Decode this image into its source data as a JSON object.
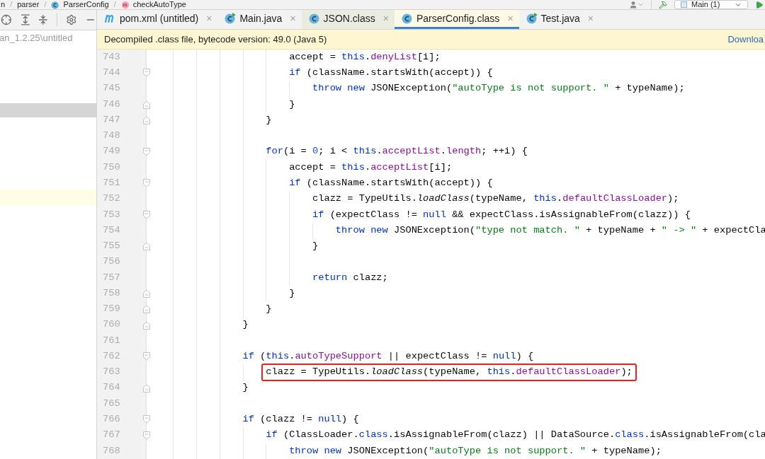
{
  "breadcrumb": [
    {
      "text": "n",
      "kind": "plain"
    },
    {
      "separator": "/",
      "text": "parser",
      "kind": "plain"
    },
    {
      "separator": "/",
      "text": "ParserConfig",
      "kind": "class"
    },
    {
      "separator": "/",
      "text": "checkAutoType",
      "kind": "method"
    }
  ],
  "run_config": {
    "label": "Main (1)"
  },
  "project_panel": {
    "path": "an_1.2.25\\untitled",
    "bands": [
      {
        "kind": "selection"
      },
      {
        "kind": "caret"
      }
    ]
  },
  "tabs": [
    {
      "label": "pom.xml (untitled)",
      "kind": "maven",
      "close": "×",
      "selected": false
    },
    {
      "label": "Main.java",
      "kind": "runnable",
      "close": "×",
      "selected": false
    },
    {
      "label": "JSON.class",
      "kind": "class",
      "close": "×",
      "selected": false,
      "color": "#e9ecdf"
    },
    {
      "label": "ParserConfig.class",
      "kind": "class",
      "close": "×",
      "selected": true,
      "color": "#fcfae6"
    },
    {
      "label": "Test.java",
      "kind": "runnable",
      "close": "×",
      "selected": false
    }
  ],
  "banner": {
    "message": "Decompiled .class file, bytecode version: 49.0 (Java 5)",
    "link": "Downloa"
  },
  "code": {
    "lines": [
      {
        "number": "743",
        "kind": "plain",
        "tokens": [
          {
            "kind": "plain",
            "text": "                        accept = "
          },
          {
            "kind": "keyword",
            "text": "this"
          },
          {
            "kind": "plain",
            "text": "."
          },
          {
            "kind": "field",
            "text": "denyList"
          },
          {
            "kind": "plain",
            "text": "[i];"
          }
        ]
      },
      {
        "number": "744",
        "kind": "opener",
        "tokens": [
          {
            "kind": "keyword",
            "text": "                        if"
          },
          {
            "kind": "plain",
            "text": " (className.startsWith(accept)) {"
          }
        ]
      },
      {
        "number": "745",
        "kind": "plain",
        "tokens": [
          {
            "kind": "keyword",
            "text": "                            throw new"
          },
          {
            "kind": "plain",
            "text": " JSONException("
          },
          {
            "kind": "string",
            "text": "\"autoType is not support. \""
          },
          {
            "kind": "plain",
            "text": " + typeName);"
          }
        ]
      },
      {
        "number": "746",
        "kind": "closer",
        "tokens": [
          {
            "kind": "plain",
            "text": "                        }"
          }
        ]
      },
      {
        "number": "747",
        "kind": "closer",
        "tokens": [
          {
            "kind": "plain",
            "text": "                    }"
          }
        ]
      },
      {
        "number": "748",
        "kind": "plain"
      },
      {
        "number": "749",
        "kind": "opener",
        "tokens": [
          {
            "kind": "keyword",
            "text": "                    for"
          },
          {
            "kind": "plain",
            "text": "(i = "
          },
          {
            "kind": "number",
            "text": "0"
          },
          {
            "kind": "plain",
            "text": "; i < "
          },
          {
            "kind": "keyword",
            "text": "this"
          },
          {
            "kind": "plain",
            "text": "."
          },
          {
            "kind": "field",
            "text": "acceptList"
          },
          {
            "kind": "plain",
            "text": "."
          },
          {
            "kind": "field",
            "text": "length"
          },
          {
            "kind": "plain",
            "text": "; ++i) {"
          }
        ]
      },
      {
        "number": "750",
        "kind": "plain",
        "tokens": [
          {
            "kind": "plain",
            "text": "                        accept = "
          },
          {
            "kind": "keyword",
            "text": "this"
          },
          {
            "kind": "plain",
            "text": "."
          },
          {
            "kind": "field",
            "text": "acceptList"
          },
          {
            "kind": "plain",
            "text": "[i];"
          }
        ]
      },
      {
        "number": "751",
        "kind": "opener",
        "tokens": [
          {
            "kind": "keyword",
            "text": "                        if"
          },
          {
            "kind": "plain",
            "text": " (className.startsWith(accept)) {"
          }
        ]
      },
      {
        "number": "752",
        "kind": "plain",
        "tokens": [
          {
            "kind": "plain",
            "text": "                            clazz = TypeUtils."
          },
          {
            "kind": "method",
            "text": "loadClass"
          },
          {
            "kind": "plain",
            "text": "(typeName, "
          },
          {
            "kind": "keyword",
            "text": "this"
          },
          {
            "kind": "plain",
            "text": "."
          },
          {
            "kind": "field",
            "text": "defaultClassLoader"
          },
          {
            "kind": "plain",
            "text": ");"
          }
        ]
      },
      {
        "number": "753",
        "kind": "opener",
        "tokens": [
          {
            "kind": "keyword",
            "text": "                            if"
          },
          {
            "kind": "plain",
            "text": " (expectClass != "
          },
          {
            "kind": "keyword",
            "text": "null"
          },
          {
            "kind": "plain",
            "text": " && expectClass.isAssignableFrom(clazz)) {"
          }
        ]
      },
      {
        "number": "754",
        "kind": "plain",
        "tokens": [
          {
            "kind": "keyword",
            "text": "                                throw new"
          },
          {
            "kind": "plain",
            "text": " JSONException("
          },
          {
            "kind": "string",
            "text": "\"type not match. \""
          },
          {
            "kind": "plain",
            "text": " + typeName + "
          },
          {
            "kind": "string",
            "text": "\" -> \""
          },
          {
            "kind": "plain",
            "text": " + expectCla"
          }
        ]
      },
      {
        "number": "755",
        "kind": "closer",
        "tokens": [
          {
            "kind": "plain",
            "text": "                            }"
          }
        ]
      },
      {
        "number": "756",
        "kind": "plain"
      },
      {
        "number": "757",
        "kind": "plain",
        "tokens": [
          {
            "kind": "keyword",
            "text": "                            return"
          },
          {
            "kind": "plain",
            "text": " clazz;"
          }
        ]
      },
      {
        "number": "758",
        "kind": "closer",
        "tokens": [
          {
            "kind": "plain",
            "text": "                        }"
          }
        ]
      },
      {
        "number": "759",
        "kind": "closer",
        "tokens": [
          {
            "kind": "plain",
            "text": "                    }"
          }
        ]
      },
      {
        "number": "760",
        "kind": "closer",
        "tokens": [
          {
            "kind": "plain",
            "text": "                }"
          }
        ]
      },
      {
        "number": "761",
        "kind": "plain"
      },
      {
        "number": "762",
        "kind": "opener",
        "tokens": [
          {
            "kind": "keyword",
            "text": "                if"
          },
          {
            "kind": "plain",
            "text": " ("
          },
          {
            "kind": "keyword",
            "text": "this"
          },
          {
            "kind": "plain",
            "text": "."
          },
          {
            "kind": "field",
            "text": "autoTypeSupport"
          },
          {
            "kind": "plain",
            "text": " || expectClass != "
          },
          {
            "kind": "keyword",
            "text": "null"
          },
          {
            "kind": "plain",
            "text": ") {"
          }
        ]
      },
      {
        "number": "763",
        "kind": "plain",
        "highlighted": true,
        "tokens": [
          {
            "kind": "plain",
            "text": "                    clazz = TypeUtils."
          },
          {
            "kind": "method",
            "text": "loadClass"
          },
          {
            "kind": "plain",
            "text": "(typeName, "
          },
          {
            "kind": "keyword",
            "text": "this"
          },
          {
            "kind": "plain",
            "text": "."
          },
          {
            "kind": "field",
            "text": "defaultClassLoader"
          },
          {
            "kind": "plain",
            "text": ");"
          }
        ]
      },
      {
        "number": "764",
        "kind": "closer",
        "tokens": [
          {
            "kind": "plain",
            "text": "                }"
          }
        ]
      },
      {
        "number": "765",
        "kind": "plain"
      },
      {
        "number": "766",
        "kind": "opener",
        "tokens": [
          {
            "kind": "keyword",
            "text": "                if"
          },
          {
            "kind": "plain",
            "text": " (clazz != "
          },
          {
            "kind": "keyword",
            "text": "null"
          },
          {
            "kind": "plain",
            "text": ") {"
          }
        ]
      },
      {
        "number": "767",
        "kind": "opener",
        "tokens": [
          {
            "kind": "keyword",
            "text": "                    if"
          },
          {
            "kind": "plain",
            "text": " (ClassLoader."
          },
          {
            "kind": "keyword",
            "text": "class"
          },
          {
            "kind": "plain",
            "text": ".isAssignableFrom(clazz) || DataSource."
          },
          {
            "kind": "keyword",
            "text": "class"
          },
          {
            "kind": "plain",
            "text": ".isAssignableFrom(cla"
          }
        ]
      },
      {
        "number": "768",
        "kind": "plain",
        "tokens": [
          {
            "kind": "keyword",
            "text": "                        throw new"
          },
          {
            "kind": "plain",
            "text": " JSONException("
          },
          {
            "kind": "string",
            "text": "\"autoType is not support. \""
          },
          {
            "kind": "plain",
            "text": " + typeName);"
          }
        ]
      }
    ]
  }
}
